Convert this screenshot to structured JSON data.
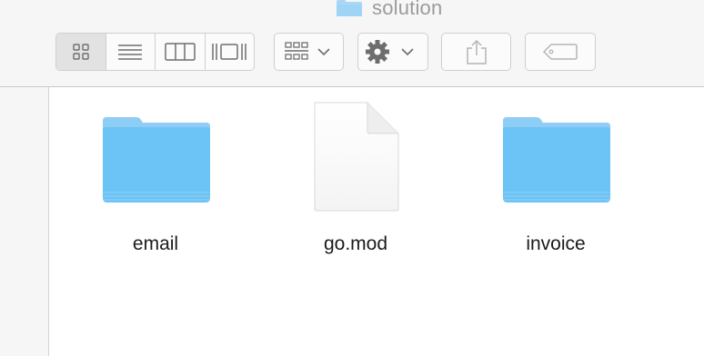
{
  "window": {
    "title": "solution"
  },
  "toolbar": {
    "view_modes": [
      {
        "name": "icon-view",
        "icon": "grid-icon",
        "active": true
      },
      {
        "name": "list-view",
        "icon": "list-icon",
        "active": false
      },
      {
        "name": "column-view",
        "icon": "columns-icon",
        "active": false
      },
      {
        "name": "gallery-view",
        "icon": "cover-flow-icon",
        "active": false
      }
    ],
    "arrange_icon": "arrange-grid-icon",
    "action_icon": "gear-icon",
    "share_icon": "share-icon",
    "tag_icon": "tag-icon"
  },
  "files": [
    {
      "name": "email",
      "kind": "folder"
    },
    {
      "name": "go.mod",
      "kind": "document"
    },
    {
      "name": "invoice",
      "kind": "folder"
    }
  ],
  "colors": {
    "folder_top": "#8dcdf6",
    "folder_body": "#6cc3f5",
    "toolbar_bg": "#f6f6f6",
    "title_text": "#9b9b9b"
  }
}
